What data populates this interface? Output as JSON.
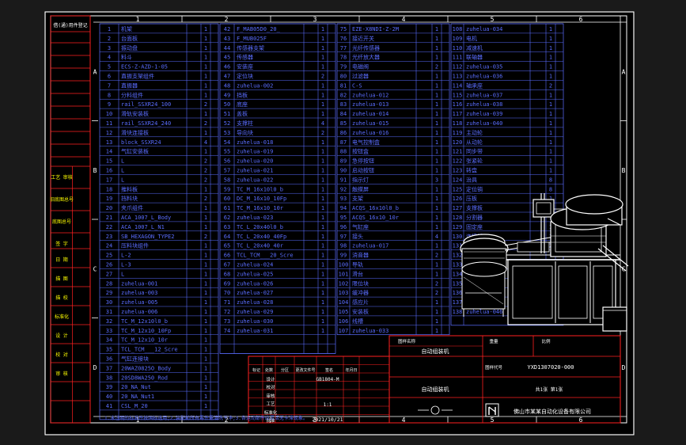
{
  "colors": {
    "background": "#1a1a1a",
    "sheet": "#000000",
    "frame": "#ffffff",
    "grid_red": "#ff2020",
    "table_blue": "#5a6dff",
    "label_white": "#ffffff",
    "label_yellow": "#ffff00"
  },
  "zone_columns": [
    "1",
    "2",
    "3",
    "4",
    "5",
    "6"
  ],
  "zone_rows": [
    "A",
    "B",
    "C",
    "D"
  ],
  "side_labels": [
    "借(通)用件登记",
    "工艺 审核",
    "旧底图总号",
    "底图总号",
    "签 字",
    "日 期",
    "描 图",
    "描 校",
    "标准化",
    "设 计",
    "校 对",
    "审 核"
  ],
  "bom_col1": [
    {
      "no": "1",
      "name": "机架",
      "qty": "1"
    },
    {
      "no": "2",
      "name": "台面板",
      "qty": "1"
    },
    {
      "no": "3",
      "name": "振动盘",
      "qty": "1"
    },
    {
      "no": "4",
      "name": "料斗",
      "qty": "1"
    },
    {
      "no": "5",
      "name": "ECS-Z-AZD-1-05",
      "qty": "1"
    },
    {
      "no": "6",
      "name": "直振支架组件",
      "qty": "1"
    },
    {
      "no": "7",
      "name": "直振器",
      "qty": "1"
    },
    {
      "no": "8",
      "name": "分料组件",
      "qty": "1"
    },
    {
      "no": "9",
      "name": "rail_SSXR24_100",
      "qty": "2"
    },
    {
      "no": "10",
      "name": "滑轨安装板",
      "qty": "1"
    },
    {
      "no": "11",
      "name": "rail_SSXR24_240",
      "qty": "2"
    },
    {
      "no": "12",
      "name": "滑块连接板",
      "qty": "1"
    },
    {
      "no": "13",
      "name": "block_SSXR24",
      "qty": "4"
    },
    {
      "no": "14",
      "name": "气缸安装板",
      "qty": "1"
    },
    {
      "no": "15",
      "name": "L",
      "qty": "2"
    },
    {
      "no": "16",
      "name": "L",
      "qty": "2"
    },
    {
      "no": "17",
      "name": "L",
      "qty": "2"
    },
    {
      "no": "18",
      "name": "推料板",
      "qty": "1"
    },
    {
      "no": "19",
      "name": "挡料块",
      "qty": "2"
    },
    {
      "no": "20",
      "name": "夹爪组件",
      "qty": "1"
    },
    {
      "no": "21",
      "name": "ACA_1007_L_Body",
      "qty": "1"
    },
    {
      "no": "22",
      "name": "ACA_1007_L_N1",
      "qty": "1"
    },
    {
      "no": "23",
      "name": "SB_HEXAGON_TYPE2",
      "qty": "2"
    },
    {
      "no": "24",
      "name": "压料块组件",
      "qty": "1"
    },
    {
      "no": "25",
      "name": "L-2",
      "qty": "1"
    },
    {
      "no": "26",
      "name": "L-3",
      "qty": "1"
    },
    {
      "no": "27",
      "name": "L",
      "qty": "1"
    },
    {
      "no": "28",
      "name": "zuhelua-001",
      "qty": "1"
    },
    {
      "no": "29",
      "name": "zuhelua-003",
      "qty": "1"
    },
    {
      "no": "30",
      "name": "zuhelua-005",
      "qty": "1"
    },
    {
      "no": "31",
      "name": "zuhelua-006",
      "qty": "1"
    },
    {
      "no": "32",
      "name": "TC_M_12x10l0_b",
      "qty": "1"
    },
    {
      "no": "33",
      "name": "TC_M_12x10_10Fp",
      "qty": "1"
    },
    {
      "no": "34",
      "name": "TC_M_12x10_10r",
      "qty": "1"
    },
    {
      "no": "35",
      "name": "TCL_TCM___12_Scre",
      "qty": "1"
    },
    {
      "no": "36",
      "name": "气缸连接块",
      "qty": "1"
    },
    {
      "no": "37",
      "name": "20WAZ0825O_Body",
      "qty": "1"
    },
    {
      "no": "38",
      "name": "20SD8WA250_Rod",
      "qty": "1"
    },
    {
      "no": "39",
      "name": "20_NA_Nut",
      "qty": "1"
    },
    {
      "no": "40",
      "name": "20_NA_Nut1",
      "qty": "1"
    },
    {
      "no": "41",
      "name": "CSL_M_20",
      "qty": "1"
    }
  ],
  "bom_col2": [
    {
      "no": "42",
      "name": "F_MAB05D0_20_",
      "qty": "1"
    },
    {
      "no": "43",
      "name": "F_MUB025F",
      "qty": "1"
    },
    {
      "no": "44",
      "name": "传感器支架",
      "qty": "1"
    },
    {
      "no": "45",
      "name": "传感器",
      "qty": "1"
    },
    {
      "no": "46",
      "name": "安装座",
      "qty": "1"
    },
    {
      "no": "47",
      "name": "定位块",
      "qty": "2"
    },
    {
      "no": "48",
      "name": "zuhelua-002",
      "qty": "1"
    },
    {
      "no": "49",
      "name": "挡板",
      "qty": "1"
    },
    {
      "no": "50",
      "name": "底座",
      "qty": "1"
    },
    {
      "no": "51",
      "name": "盖板",
      "qty": "1"
    },
    {
      "no": "52",
      "name": "支撑柱",
      "qty": "4"
    },
    {
      "no": "53",
      "name": "导向块",
      "qty": "2"
    },
    {
      "no": "54",
      "name": "zuhelua-018",
      "qty": "1"
    },
    {
      "no": "55",
      "name": "zuhelua-019",
      "qty": "1"
    },
    {
      "no": "56",
      "name": "zuhelua-020",
      "qty": "1"
    },
    {
      "no": "57",
      "name": "zuhelua-021",
      "qty": "1"
    },
    {
      "no": "58",
      "name": "zuhelua-022",
      "qty": "1"
    },
    {
      "no": "59",
      "name": "TC_M_16x10l0_b",
      "qty": "1"
    },
    {
      "no": "60",
      "name": "DC_M_16x10_10Fp",
      "qty": "1"
    },
    {
      "no": "61",
      "name": "TC_M_16x10_10r",
      "qty": "1"
    },
    {
      "no": "62",
      "name": "zuhelua-023",
      "qty": "1"
    },
    {
      "no": "63",
      "name": "TC_L_20x40l0_b",
      "qty": "1"
    },
    {
      "no": "64",
      "name": "TC_L_20x40_40Fp",
      "qty": "1"
    },
    {
      "no": "65",
      "name": "TC_L_20x40_40r",
      "qty": "1"
    },
    {
      "no": "66",
      "name": "TCL_TCM___20_Scre",
      "qty": "1"
    },
    {
      "no": "67",
      "name": "zuhelua-024",
      "qty": "1"
    },
    {
      "no": "68",
      "name": "zuhelua-025",
      "qty": "1"
    },
    {
      "no": "69",
      "name": "zuhelua-026",
      "qty": "1"
    },
    {
      "no": "70",
      "name": "zuhelua-027",
      "qty": "1"
    },
    {
      "no": "71",
      "name": "zuhelua-028",
      "qty": "1"
    },
    {
      "no": "72",
      "name": "zuhelua-029",
      "qty": "1"
    },
    {
      "no": "73",
      "name": "zuhelua-030",
      "qty": "1"
    },
    {
      "no": "74",
      "name": "zuhelua-031",
      "qty": "1"
    }
  ],
  "bom_col3": [
    {
      "no": "75",
      "name": "EZE-X8NDI-Z-2M",
      "qty": "1"
    },
    {
      "no": "76",
      "name": "接近开关",
      "qty": "1"
    },
    {
      "no": "77",
      "name": "光纤传感器",
      "qty": "1"
    },
    {
      "no": "78",
      "name": "光纤放大器",
      "qty": "1"
    },
    {
      "no": "79",
      "name": "电磁阀",
      "qty": "2"
    },
    {
      "no": "80",
      "name": "过滤器",
      "qty": "1"
    },
    {
      "no": "81",
      "name": "C-S",
      "qty": "1"
    },
    {
      "no": "82",
      "name": "zuhelua-012",
      "qty": "1"
    },
    {
      "no": "83",
      "name": "zuhelua-013",
      "qty": "1"
    },
    {
      "no": "84",
      "name": "zuhelua-014",
      "qty": "1"
    },
    {
      "no": "85",
      "name": "zuhelua-015",
      "qty": "1"
    },
    {
      "no": "86",
      "name": "zuhelua-016",
      "qty": "1"
    },
    {
      "no": "87",
      "name": "电气控制盒",
      "qty": "1"
    },
    {
      "no": "88",
      "name": "按钮盒",
      "qty": "1"
    },
    {
      "no": "89",
      "name": "急停按钮",
      "qty": "1"
    },
    {
      "no": "90",
      "name": "启动按钮",
      "qty": "1"
    },
    {
      "no": "91",
      "name": "指示灯",
      "qty": "3"
    },
    {
      "no": "92",
      "name": "触摸屏",
      "qty": "1"
    },
    {
      "no": "93",
      "name": "支架",
      "qty": "1"
    },
    {
      "no": "94",
      "name": "ACQS_16x10l0_b",
      "qty": "1"
    },
    {
      "no": "95",
      "name": "ACQS_16x10_10r",
      "qty": "1"
    },
    {
      "no": "96",
      "name": "气缸座",
      "qty": "1"
    },
    {
      "no": "97",
      "name": "接头",
      "qty": "4"
    },
    {
      "no": "98",
      "name": "zuhelua-017",
      "qty": "1"
    },
    {
      "no": "99",
      "name": "消音器",
      "qty": "2"
    },
    {
      "no": "100",
      "name": "导轨",
      "qty": "1"
    },
    {
      "no": "101",
      "name": "滑台",
      "qty": "1"
    },
    {
      "no": "102",
      "name": "限位块",
      "qty": "2"
    },
    {
      "no": "103",
      "name": "缓冲器",
      "qty": "2"
    },
    {
      "no": "104",
      "name": "感应片",
      "qty": "1"
    },
    {
      "no": "105",
      "name": "安装板",
      "qty": "1"
    },
    {
      "no": "106",
      "name": "线槽",
      "qty": "1"
    },
    {
      "no": "107",
      "name": "zuhelua-033",
      "qty": "1"
    }
  ],
  "bom_col4": [
    {
      "no": "108",
      "name": "zuhelua-034",
      "qty": "1"
    },
    {
      "no": "109",
      "name": "电机",
      "qty": "1"
    },
    {
      "no": "110",
      "name": "减速机",
      "qty": "1"
    },
    {
      "no": "111",
      "name": "联轴器",
      "qty": "1"
    },
    {
      "no": "112",
      "name": "zuhelua-035",
      "qty": "1"
    },
    {
      "no": "113",
      "name": "zuhelua-036",
      "qty": "1"
    },
    {
      "no": "114",
      "name": "轴承座",
      "qty": "2"
    },
    {
      "no": "115",
      "name": "zuhelua-037",
      "qty": "1"
    },
    {
      "no": "116",
      "name": "zuhelua-038",
      "qty": "1"
    },
    {
      "no": "117",
      "name": "zuhelua-039",
      "qty": "1"
    },
    {
      "no": "118",
      "name": "zuhelua-040",
      "qty": "1"
    },
    {
      "no": "119",
      "name": "主动轮",
      "qty": "1"
    },
    {
      "no": "120",
      "name": "从动轮",
      "qty": "1"
    },
    {
      "no": "121",
      "name": "同步带",
      "qty": "1"
    },
    {
      "no": "122",
      "name": "张紧轮",
      "qty": "1"
    },
    {
      "no": "123",
      "name": "转盘",
      "qty": "1"
    },
    {
      "no": "124",
      "name": "治具",
      "qty": "8"
    },
    {
      "no": "125",
      "name": "定位销",
      "qty": "8"
    },
    {
      "no": "126",
      "name": "压板",
      "qty": "1"
    },
    {
      "no": "127",
      "name": "支撑板",
      "qty": "1"
    },
    {
      "no": "128",
      "name": "分割器",
      "qty": "1"
    },
    {
      "no": "129",
      "name": "固定座",
      "qty": "1"
    },
    {
      "no": "130",
      "name": "连接板",
      "qty": "1"
    },
    {
      "no": "131",
      "name": "挡块",
      "qty": "2"
    },
    {
      "no": "132",
      "name": "E3T-CD11-2M",
      "qty": "1"
    },
    {
      "no": "133",
      "name": "L",
      "qty": "1"
    },
    {
      "no": "134",
      "name": "zuhelua-044",
      "qty": "1"
    },
    {
      "no": "135",
      "name": "顶升气缸",
      "qty": "1"
    },
    {
      "no": "136",
      "name": "吸嘴组件",
      "qty": "1"
    },
    {
      "no": "137",
      "name": "真空发生器",
      "qty": "1"
    },
    {
      "no": "138",
      "name": "zuhelua-046",
      "qty": "1"
    }
  ],
  "title_block": {
    "drawing_name": "自动组装机",
    "drawing_number": "YXD1307020-000",
    "material": "GB1804-M",
    "scale": "1:1",
    "date": "2021/10/21",
    "company": "佛山市某某自动化设备有限公司",
    "sheet_info": "共1张 第1张",
    "labels": [
      "标记",
      "处数",
      "分区",
      "更改文件号",
      "签名",
      "年月日",
      "设计",
      "校对",
      "审核",
      "工艺",
      "标准化",
      "批准",
      "阶段标记",
      "重量",
      "比例",
      "图样名称",
      "图样代号"
    ]
  },
  "bottom_note": "1.未注明的标准件按国标选用;2.装配前所有零件需清洗干净;3.各运动部件应灵活无卡滞现象。"
}
